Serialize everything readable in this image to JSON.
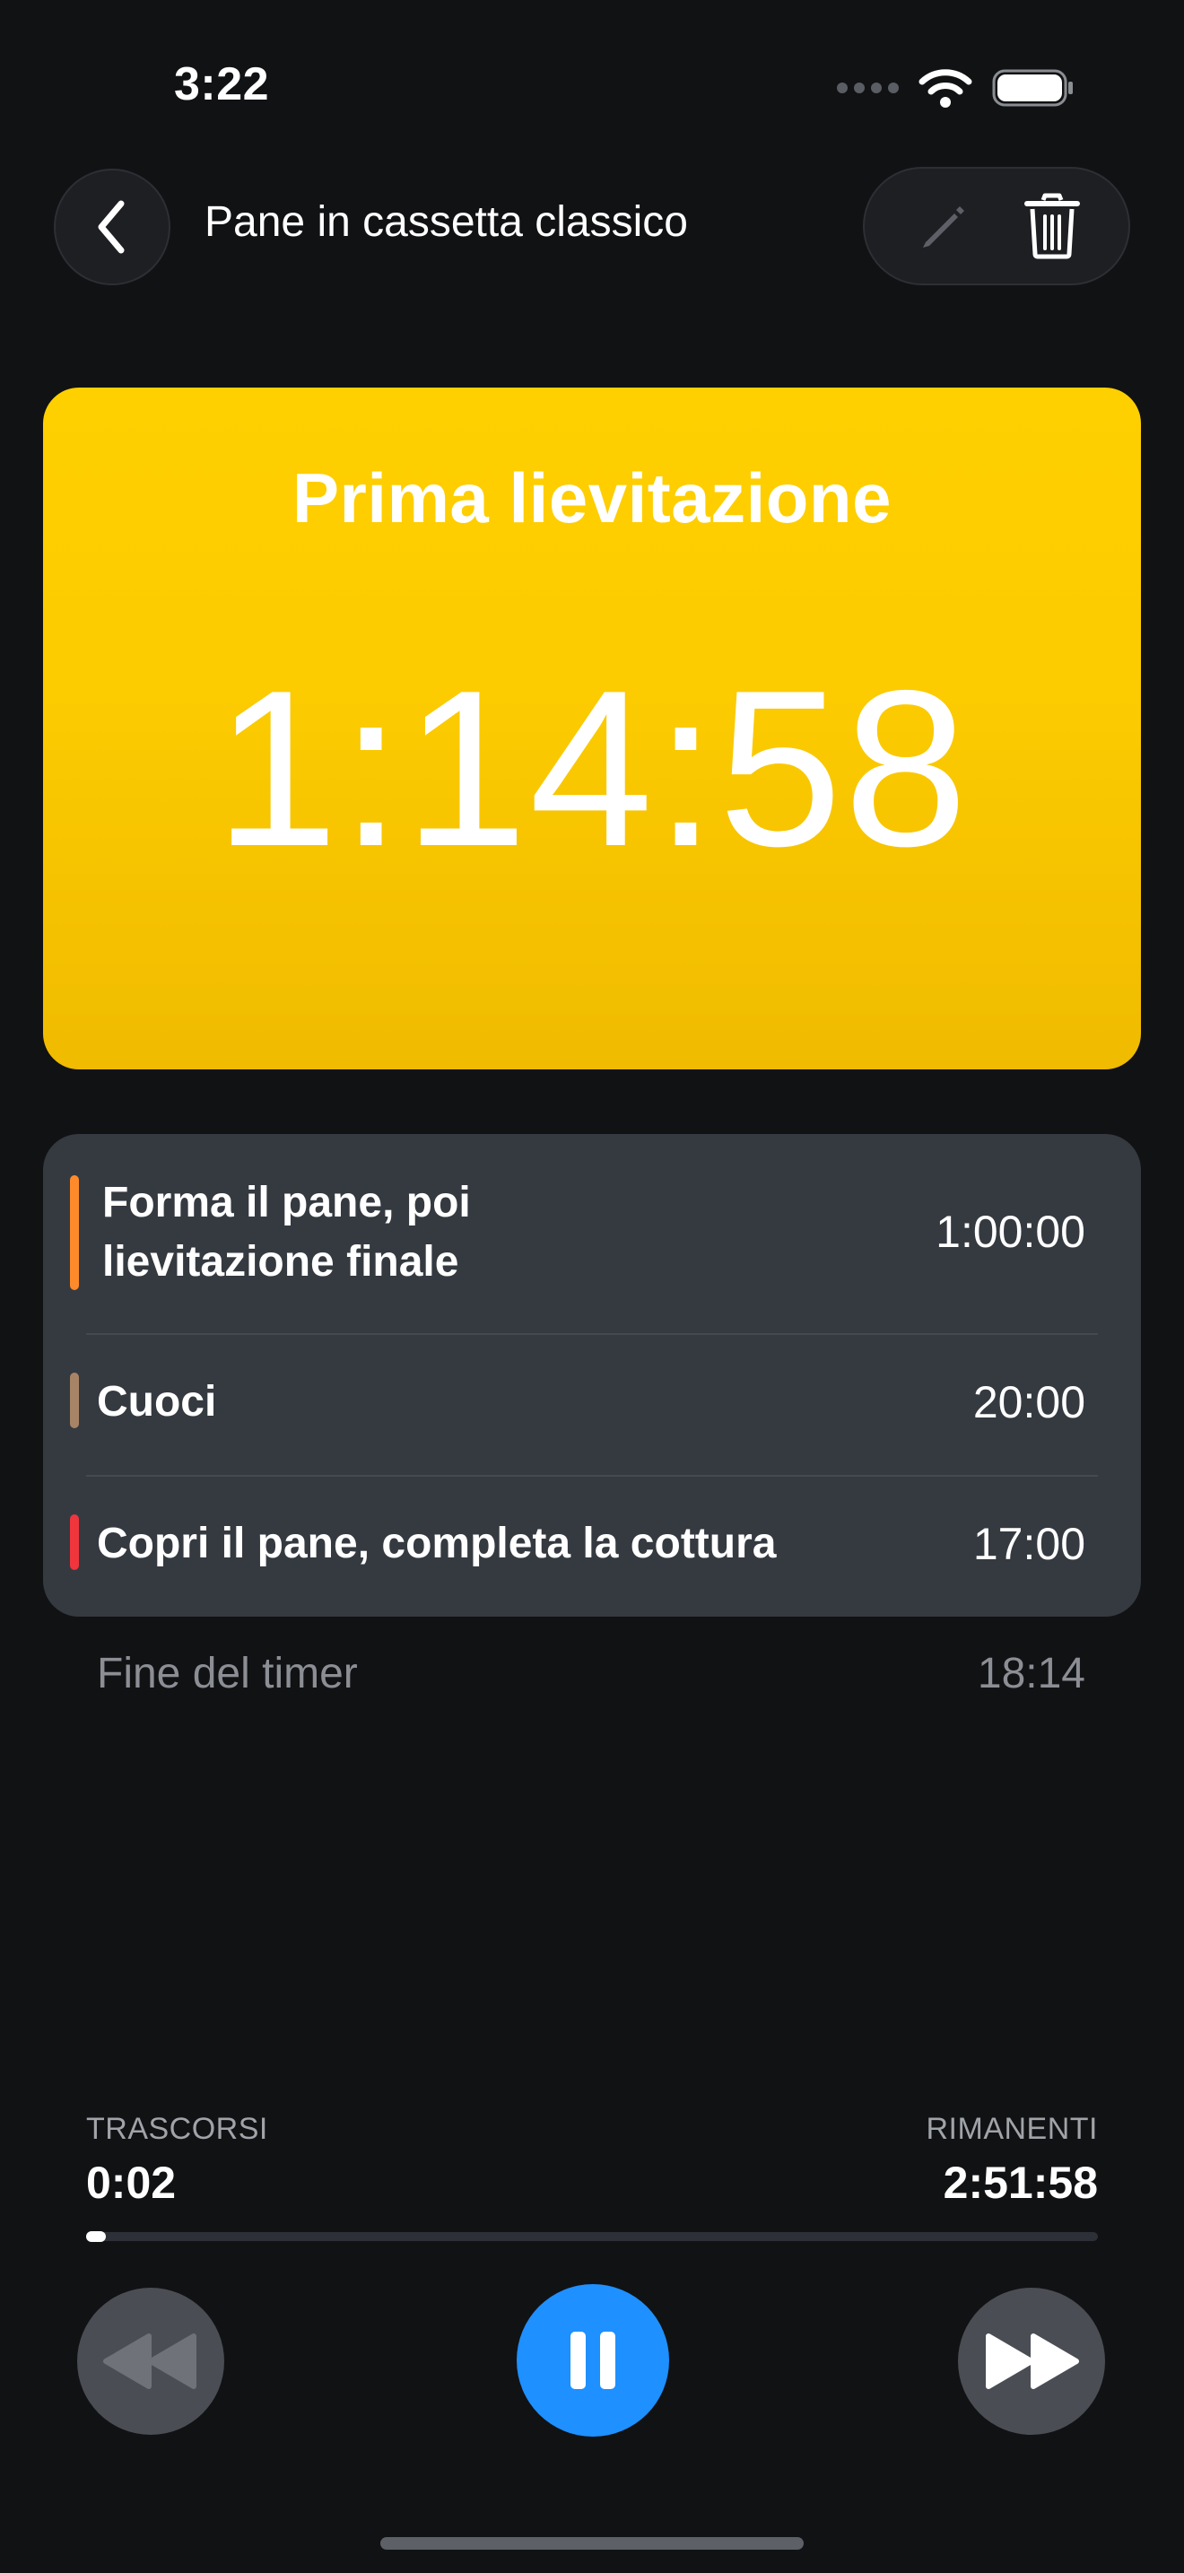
{
  "status_bar": {
    "time": "3:22",
    "icons": [
      "signal-dots-icon",
      "wifi-icon",
      "battery-icon"
    ]
  },
  "header": {
    "back_icon": "chevron-left-icon",
    "title": "Pane in cassetta classico",
    "edit_icon": "pencil-icon",
    "delete_icon": "trash-icon"
  },
  "current_step": {
    "title": "Prima lievitazione",
    "remaining": "1:14:58",
    "color": "#FFCC00"
  },
  "steps": [
    {
      "label_line1": "Forma il pane, poi",
      "label_line2": "lievitazione finale",
      "duration": "1:00:00",
      "color": "#FF8A2A"
    },
    {
      "label_line1": "Cuoci",
      "label_line2": "",
      "duration": "20:00",
      "color": "#A88466"
    },
    {
      "label_line1": "Copri il pane, completa la cottura",
      "label_line2": "",
      "duration": "17:00",
      "color": "#F0353D"
    }
  ],
  "end": {
    "label": "Fine del timer",
    "time": "18:14"
  },
  "progress": {
    "elapsed_label": "TRASCORSI",
    "elapsed_value": "0:02",
    "remaining_label": "RIMANENTI",
    "remaining_value": "2:51:58",
    "fraction": 0.0002
  },
  "controls": {
    "previous_icon": "rewind-icon",
    "pause_icon": "pause-icon",
    "next_icon": "fast-forward-icon",
    "accent": "#1E90FF"
  }
}
